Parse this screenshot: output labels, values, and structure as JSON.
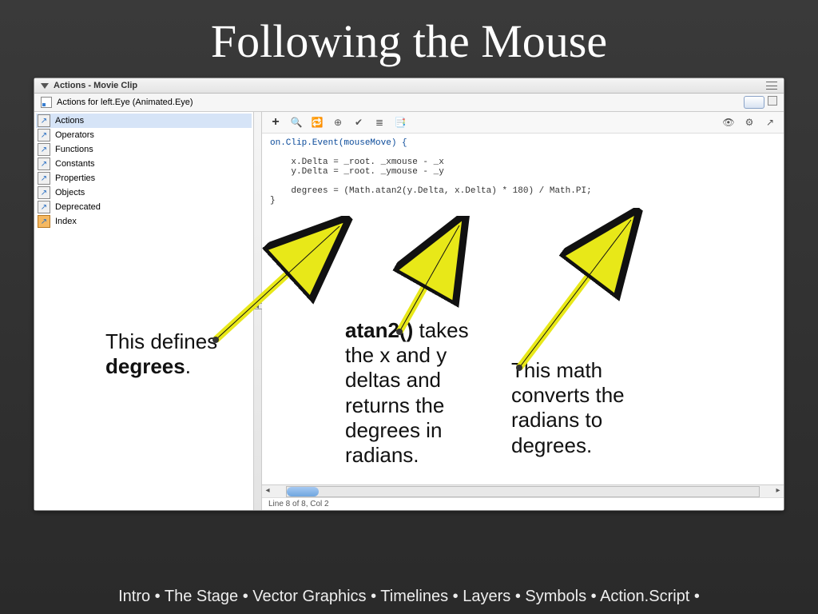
{
  "slide": {
    "title": "Following the Mouse"
  },
  "panel": {
    "header": "Actions - Movie Clip",
    "subheader": "Actions for left.Eye  (Animated.Eye)"
  },
  "books": [
    {
      "label": "Actions",
      "selected": true
    },
    {
      "label": "Operators"
    },
    {
      "label": "Functions"
    },
    {
      "label": "Constants"
    },
    {
      "label": "Properties"
    },
    {
      "label": "Objects"
    },
    {
      "label": "Deprecated"
    },
    {
      "label": "Index",
      "orange": true
    }
  ],
  "code": {
    "l1": "on.Clip.Event(mouseMove) {",
    "l2": "",
    "l3": "    x.Delta = _root. _xmouse - _x",
    "l4": "    y.Delta = _root. _ymouse - _y",
    "l5": "",
    "l6": "    degrees = (Math.atan2(y.Delta, x.Delta) * 180) / Math.PI;",
    "l7": "}"
  },
  "status": "Line 8 of 8, Col 2",
  "annotations": {
    "a1": "This defines degrees.",
    "a2": "atan2() takes the x and y deltas and returns the degrees in radians.",
    "a3": "This math converts the radians to degrees."
  },
  "footer": "Intro • The Stage • Vector Graphics • Timelines • Layers • Symbols • Action.Script •"
}
